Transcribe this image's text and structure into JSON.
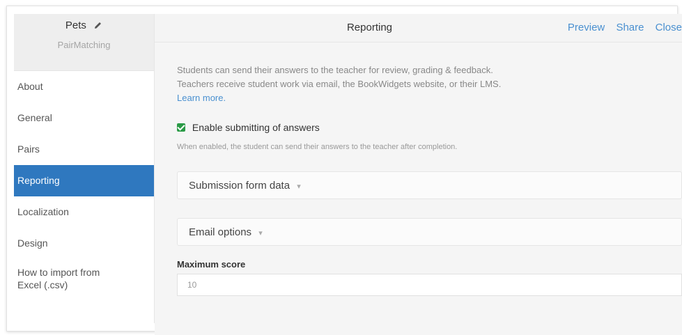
{
  "widget": {
    "name": "Pets",
    "type": "PairMatching"
  },
  "sidebar": {
    "items": [
      {
        "label": "About"
      },
      {
        "label": "General"
      },
      {
        "label": "Pairs"
      },
      {
        "label": "Reporting",
        "active": true
      },
      {
        "label": "Localization"
      },
      {
        "label": "Design"
      },
      {
        "label": "How to import from Excel (.csv)"
      }
    ]
  },
  "header": {
    "title": "Reporting",
    "preview_label": "Preview",
    "share_label": "Share",
    "close_label": "Close"
  },
  "content": {
    "description_line1": "Students can send their answers to the teacher for review, grading & feedback.",
    "description_line2": "Teachers receive student work via email, the BookWidgets website, or their LMS.",
    "learn_more": "Learn more.",
    "enable_label": "Enable submitting of answers",
    "enable_checked": true,
    "enable_hint": "When enabled, the student can send their answers to the teacher after completion.",
    "submission_panel": "Submission form data",
    "email_panel": "Email options",
    "max_score_label": "Maximum score",
    "max_score_value": "10"
  },
  "colors": {
    "accent": "#2f78bf",
    "link": "#4a90d0",
    "check": "#2a9a46"
  },
  "icons": {
    "edit": "pencil-icon",
    "caret": "chevron-down-icon"
  }
}
